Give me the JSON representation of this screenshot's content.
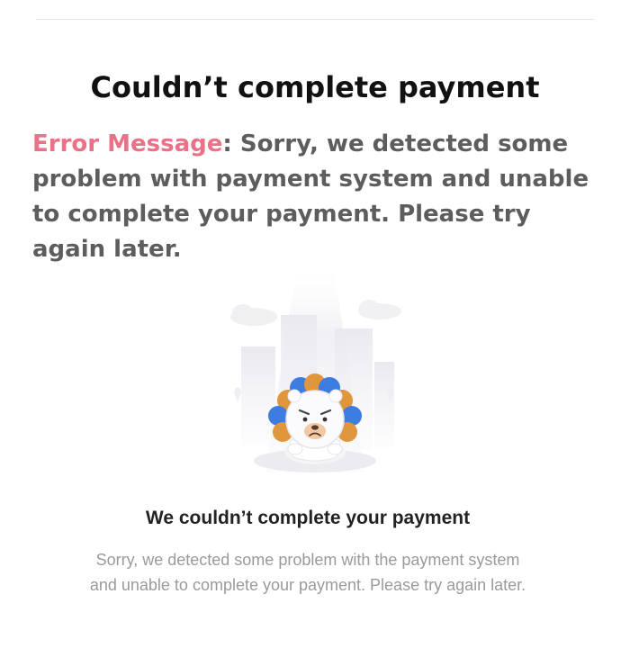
{
  "page": {
    "title": "Couldn’t complete payment"
  },
  "error": {
    "label": "Error Message",
    "separator": ": ",
    "text": "Sorry, we detected some problem with payment system and unable to complete your payment. Please try again later."
  },
  "dialog": {
    "illustration_icon": "sad-bear-icon",
    "heading": "We couldn’t complete your payment",
    "body": "Sorry, we detected some problem with the payment system and unable to complete your payment. Please try again later."
  },
  "colors": {
    "error_label": "#ea7187",
    "error_text": "#5d5d5d",
    "heading": "#222222",
    "body_text": "#9a9a9a",
    "petal_blue": "#3d7ce0",
    "petal_orange": "#e0963a"
  }
}
